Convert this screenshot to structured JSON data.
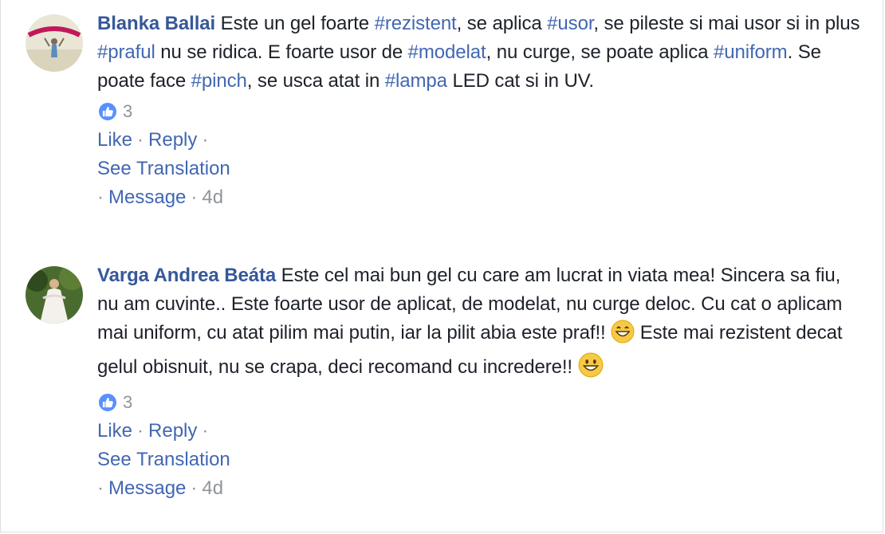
{
  "comments": [
    {
      "author": "Blanka Ballai",
      "segments": [
        {
          "t": " Este un gel foarte "
        },
        {
          "tag": "#rezistent"
        },
        {
          "t": ", se aplica "
        },
        {
          "tag": "#usor"
        },
        {
          "t": ", se pileste si mai usor si in plus "
        },
        {
          "tag": "#praful"
        },
        {
          "t": " nu se ridica. E foarte usor de "
        },
        {
          "tag": "#modelat"
        },
        {
          "t": ", nu curge, se poate aplica "
        },
        {
          "tag": "#uniform"
        },
        {
          "t": ". Se poate face "
        },
        {
          "tag": "#pinch"
        },
        {
          "t": ", se usca atat in "
        },
        {
          "tag": "#lampa"
        },
        {
          "t": " LED cat si in UV."
        }
      ],
      "reaction_count": "3",
      "like_label": "Like",
      "reply_label": "Reply",
      "see_translation_label": "See Translation",
      "message_label": "Message",
      "time": "4d"
    },
    {
      "author": "Varga Andrea Beáta",
      "text_part1": " Este cel mai bun gel cu care am lucrat in viata mea! Sincera sa fiu, nu am cuvinte.. Este foarte usor de aplicat, de modelat, nu curge deloc. Cu cat o aplicam mai uniform, cu atat pilim mai putin, iar la pilit abia este praf!! ",
      "text_part2": " Este mai rezistent decat gelul obisnuit, nu se crapa, deci recomand cu incredere!! ",
      "reaction_count": "3",
      "like_label": "Like",
      "reply_label": "Reply",
      "see_translation_label": "See Translation",
      "message_label": "Message",
      "time": "4d"
    }
  ],
  "colors": {
    "author": "#365899",
    "link": "#4267b2",
    "meta": "#90949c",
    "like_badge": "#5890ff"
  },
  "icons": [
    "like-reaction-icon",
    "grinning-emoji-icon",
    "smiling-emoji-icon"
  ]
}
